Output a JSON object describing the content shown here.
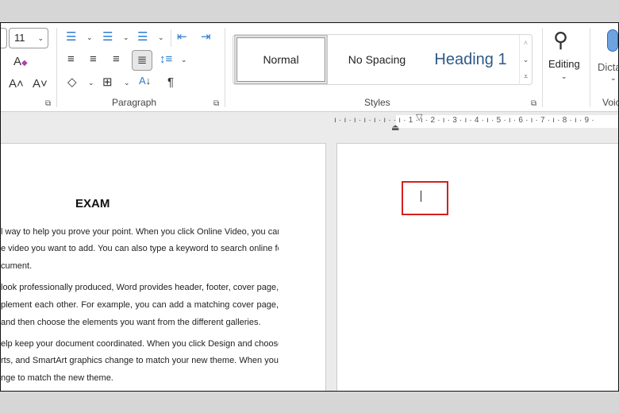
{
  "ribbon": {
    "font_size": "11",
    "paragraph_group_label": "Paragraph",
    "styles_group_label": "Styles",
    "styles": [
      "Normal",
      "No Spacing",
      "Heading 1"
    ],
    "editing_label": "Editing",
    "dictate_label": "Dicta",
    "voice_group_label": "Voic",
    "icons": [
      "clear-formatting-icon",
      "grow-font-icon",
      "shrink-font-icon",
      "bullets-icon",
      "numbering-icon",
      "multilevel-list-icon",
      "decrease-indent-icon",
      "increase-indent-icon",
      "align-left-icon",
      "align-center-icon",
      "align-right-icon",
      "justify-icon",
      "line-spacing-icon",
      "shading-icon",
      "borders-icon",
      "sort-icon",
      "show-formatting-marks-icon",
      "search-icon",
      "microphone-icon"
    ]
  },
  "ruler": {
    "marks": "ı · ı · ı · ı · ı · ı ·  · ı · 1 · ı · 2 · ı · 3 · ı · 4 · ı · 5 · ı · 6 · ı · 7 · ı · 8 · ı · 9 ·"
  },
  "document": {
    "title": "EXAM",
    "lines": [
      "l way to help you prove your point. When you click Online Video, you can",
      "e video you want to add. You can also type a keyword to search online for",
      "cument.",
      "look professionally produced, Word provides header, footer, cover page,",
      "plement each other. For example, you can add a matching cover page,",
      " and then choose the elements you want from the different galleries.",
      "elp keep your document coordinated. When you click Design and choose",
      "rts, and SmartArt graphics change to match your new theme. When you",
      "nge to match the new theme."
    ]
  },
  "colors": {
    "highlight_box": "#d42020",
    "heading_style": "#2e5a88",
    "accent_icon": "#2b7cd3"
  }
}
